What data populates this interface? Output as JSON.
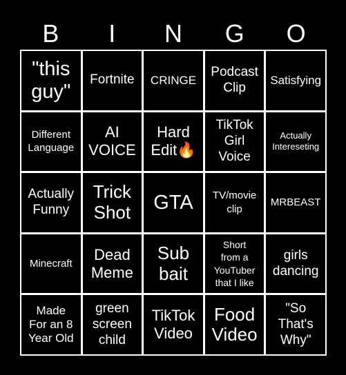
{
  "header": {
    "letters": [
      "B",
      "I",
      "N",
      "G",
      "O"
    ]
  },
  "colors": {
    "background": "#000000",
    "text": "#ffffff",
    "grid_lines": "#ffffff"
  },
  "board": {
    "cells": [
      "\"this\nguy\"",
      "Fortnite",
      "CRINGE",
      "Podcast\nClip",
      "Satisfying",
      "Different\nLanguage",
      "AI\nVOICE",
      "Hard\nEdit🔥",
      "TikTok\nGirl\nVoice",
      "Actually\nIntereseting",
      "Actually\nFunny",
      "Trick\nShot",
      "GTA",
      "TV/movie\nclip",
      "MRBEAST",
      "Minecraft",
      "Dead\nMeme",
      "Sub\nbait",
      "Short\nfrom a\nYouTuber\nthat I like",
      "girls\ndancing",
      "Made\nFor an 8\nYear Old",
      "green\nscreen\nchild",
      "TikTok\nVideo",
      "Food\nVideo",
      "\"So\nThat's\nWhy\""
    ]
  }
}
